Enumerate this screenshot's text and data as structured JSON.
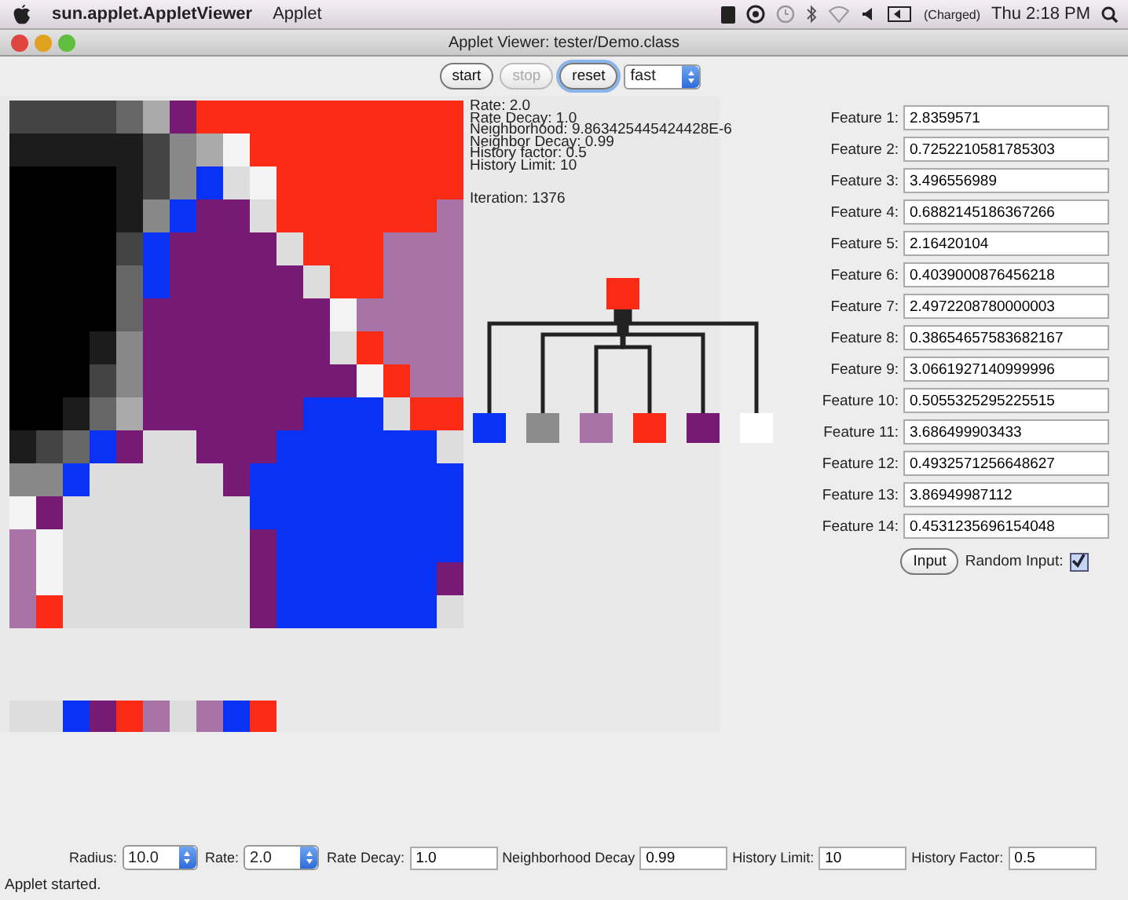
{
  "menu_bar": {
    "app_name": "sun.applet.AppletViewer",
    "menus": [
      "Applet"
    ],
    "battery_status": "(Charged)",
    "clock": "Thu 2:18 PM"
  },
  "window": {
    "title": "Applet Viewer: tester/Demo.class"
  },
  "toolbar": {
    "buttons": [
      {
        "label": "start",
        "disabled": false,
        "focused": false
      },
      {
        "label": "stop",
        "disabled": true,
        "focused": false
      },
      {
        "label": "reset",
        "disabled": false,
        "focused": true
      }
    ],
    "speed": "fast"
  },
  "parameters": [
    {
      "label": "Rate:",
      "value": "2.0"
    },
    {
      "label": "Rate Decay:",
      "value": "1.0"
    },
    {
      "label": "Neighborhood:",
      "value": "9.863425445424428E-6"
    },
    {
      "label": "Neighbor Decay:",
      "value": "0.99"
    },
    {
      "label": "History factor:",
      "value": "0.5"
    },
    {
      "label": "History Limit:",
      "value": "10"
    }
  ],
  "iteration": "Iteration: 1376",
  "tree": {
    "root": {
      "color": "#fb2a14"
    },
    "children": [
      {
        "color": "#0a32f5"
      },
      {
        "color": "#8c8c8c"
      },
      {
        "color": "#a874a8"
      },
      {
        "color": "#fb2a14"
      },
      {
        "color": "#761a76"
      },
      {
        "color": "#ffffff"
      }
    ]
  },
  "strip": [
    {
      "color": "#dddddd"
    },
    {
      "color": "#dddddd"
    },
    {
      "color": "#0a32f5"
    },
    {
      "color": "#761a76"
    },
    {
      "color": "#fb2a14"
    },
    {
      "color": "#a874a8"
    },
    {
      "color": "#dddddd"
    },
    {
      "color": "#a874a8"
    },
    {
      "color": "#0a32f5"
    },
    {
      "color": "#fb2a14"
    }
  ],
  "features": [
    {
      "label": "Feature 1:",
      "value": "2.8359571"
    },
    {
      "label": "Feature 2:",
      "value": "0.7252210581785303"
    },
    {
      "label": "Feature 3:",
      "value": "3.496556989"
    },
    {
      "label": "Feature 4:",
      "value": "0.6882145186367266"
    },
    {
      "label": "Feature 5:",
      "value": "2.16420104"
    },
    {
      "label": "Feature 6:",
      "value": "0.4039000876456218"
    },
    {
      "label": "Feature 7:",
      "value": "2.4972208780000003"
    },
    {
      "label": "Feature 8:",
      "value": "0.38654657583682167"
    },
    {
      "label": "Feature 9:",
      "value": "3.0661927140999996"
    },
    {
      "label": "Feature 10:",
      "value": "0.5055325295225515"
    },
    {
      "label": "Feature 11:",
      "value": "3.686499903433"
    },
    {
      "label": "Feature 12:",
      "value": "0.4932571256648627"
    },
    {
      "label": "Feature 13:",
      "value": "3.86949987112"
    },
    {
      "label": "Feature 14:",
      "value": "0.4531235696154048"
    }
  ],
  "input_button": "Input",
  "random_input": {
    "label": "Random Input:",
    "checked": true
  },
  "settings": [
    {
      "kind": "select",
      "label": "Radius:",
      "value": "10.0"
    },
    {
      "kind": "select",
      "label": "Rate:",
      "value": "2.0"
    },
    {
      "kind": "field",
      "label": "Rate Decay:",
      "value": "1.0"
    },
    {
      "kind": "field",
      "label": "Neighborhood Decay",
      "value": "0.99"
    },
    {
      "kind": "field",
      "label": "History Limit:",
      "value": "10"
    },
    {
      "kind": "field",
      "label": "History Factor:",
      "value": "0.5"
    }
  ],
  "status_bar": "Applet started."
}
